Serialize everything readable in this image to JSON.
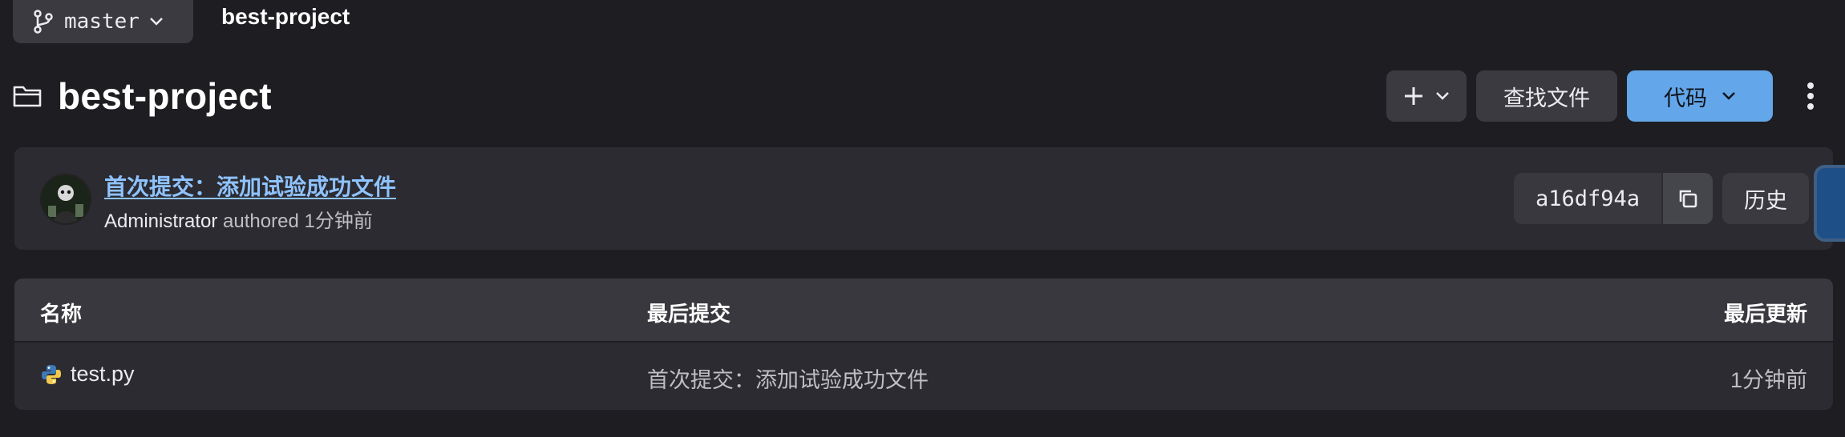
{
  "breadcrumb": {
    "branch": "master",
    "project": "best-project"
  },
  "header": {
    "title": "best-project",
    "find_file_label": "查找文件",
    "code_label": "代码"
  },
  "last_commit": {
    "message": "首次提交：添加试验成功文件",
    "author": "Administrator",
    "authored_text": "authored",
    "time": "1分钟前",
    "sha": "a16df94a",
    "history_label": "历史"
  },
  "table": {
    "columns": [
      "名称",
      "最后提交",
      "最后更新"
    ],
    "rows": [
      {
        "name": "test.py",
        "icon": "python-file-icon",
        "last_commit": "首次提交：添加试验成功文件",
        "last_update": "1分钟前"
      }
    ]
  },
  "colors": {
    "background": "#1e1e22",
    "panel": "#2b2b31",
    "button": "#3a3a40",
    "accent": "#63a6e9",
    "link": "#8fc3ff"
  }
}
